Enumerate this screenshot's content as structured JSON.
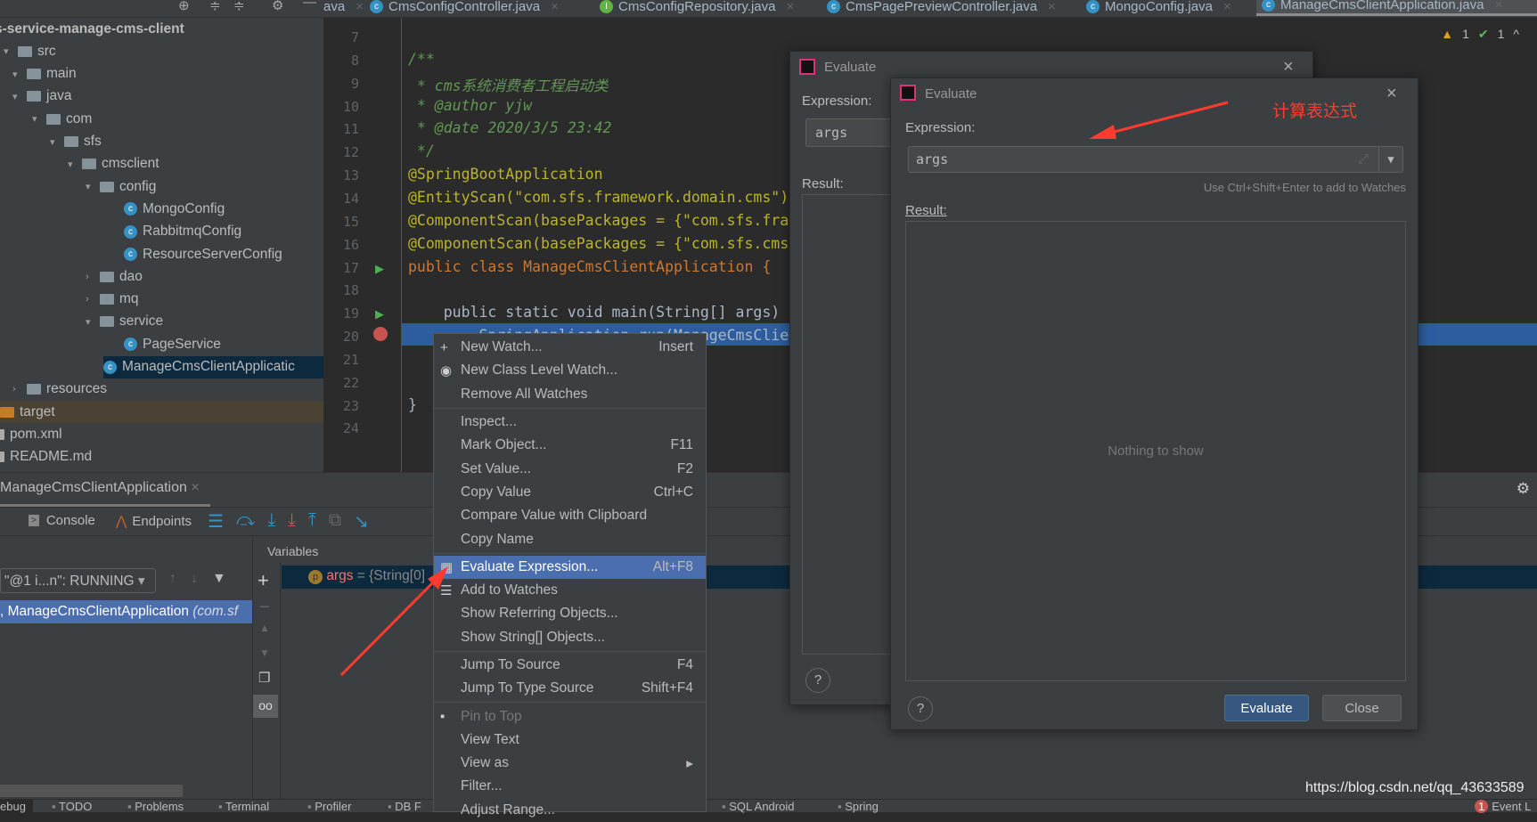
{
  "editor_tabs": [
    {
      "label": "ava",
      "icon": "none"
    },
    {
      "label": "CmsConfigController.java",
      "icon": "class-icon"
    },
    {
      "label": "CmsConfigRepository.java",
      "icon": "interface-icon"
    },
    {
      "label": "CmsPagePreviewController.java",
      "icon": "class-icon"
    },
    {
      "label": "MongoConfig.java",
      "icon": "class-icon"
    },
    {
      "label": "ManageCmsClientApplication.java",
      "icon": "spring-class-icon",
      "active": true
    }
  ],
  "inspections": {
    "warnings": "1",
    "ok": "1"
  },
  "project_tree": [
    {
      "label": "s-service-manage-cms-client",
      "bold": true
    },
    {
      "label": "src",
      "type": "folder"
    },
    {
      "label": "main",
      "type": "folder"
    },
    {
      "label": "java",
      "type": "folder"
    },
    {
      "label": "com",
      "type": "package"
    },
    {
      "label": "sfs",
      "type": "package"
    },
    {
      "label": "cmsclient",
      "type": "package"
    },
    {
      "label": "config",
      "type": "package"
    },
    {
      "label": "MongoConfig",
      "type": "class"
    },
    {
      "label": "RabbitmqConfig",
      "type": "class"
    },
    {
      "label": "ResourceServerConfig",
      "type": "class"
    },
    {
      "label": "dao",
      "type": "package"
    },
    {
      "label": "mq",
      "type": "package"
    },
    {
      "label": "service",
      "type": "package"
    },
    {
      "label": "PageService",
      "type": "class"
    },
    {
      "label": "ManageCmsClientApplicatic",
      "type": "class"
    },
    {
      "label": "resources",
      "type": "folder"
    },
    {
      "label": "target",
      "type": "folder"
    },
    {
      "label": "pom.xml",
      "type": "file"
    },
    {
      "label": "README.md",
      "type": "file"
    }
  ],
  "code_lines": [
    {
      "n": "7",
      "t": ""
    },
    {
      "n": "8",
      "t": "/**"
    },
    {
      "n": "9",
      "t": " * cms系统消费者工程启动类"
    },
    {
      "n": "10",
      "t": " * @author yjw"
    },
    {
      "n": "11",
      "t": " * @date 2020/3/5 23:42"
    },
    {
      "n": "12",
      "t": " */"
    },
    {
      "n": "13",
      "t": "@SpringBootApplication"
    },
    {
      "n": "14",
      "t": "@EntityScan(\"com.sfs.framework.domain.cms\")"
    },
    {
      "n": "15",
      "t": "@ComponentScan(basePackages = {\"com.sfs.fra"
    },
    {
      "n": "16",
      "t": "@ComponentScan(basePackages = {\"com.sfs.cms"
    },
    {
      "n": "17",
      "t": "public class ManageCmsClientApplication {"
    },
    {
      "n": "18",
      "t": ""
    },
    {
      "n": "19",
      "t": "    public static void main(String[] args)"
    },
    {
      "n": "20",
      "t": "        SpringApplication.run(ManageCmsClie"
    },
    {
      "n": "21",
      "t": ""
    },
    {
      "n": "22",
      "t": ""
    },
    {
      "n": "23",
      "t": "}"
    },
    {
      "n": "24",
      "t": ""
    }
  ],
  "debug": {
    "session_tab": "ManageCmsClientApplication",
    "console_tab": "Console",
    "endpoints_tab": "Endpoints",
    "thread_select": "\"@1 i...n\": RUNNING",
    "frame": ", ManageCmsClientApplication",
    "frame_pkg": "(com.sf",
    "variables_header": "Variables",
    "variable_name": "args",
    "variable_value": " = {String[0]"
  },
  "context_menu": [
    {
      "label": "New Watch...",
      "shortcut": "Insert",
      "icon": "plus-icon"
    },
    {
      "label": "New Class Level Watch...",
      "icon": "class-watch-icon"
    },
    {
      "label": "Remove All Watches"
    },
    {
      "sep": true
    },
    {
      "label": "Inspect..."
    },
    {
      "label": "Mark Object...",
      "shortcut": "F11"
    },
    {
      "label": "Set Value...",
      "shortcut": "F2"
    },
    {
      "label": "Copy Value",
      "shortcut": "Ctrl+C"
    },
    {
      "label": "Compare Value with Clipboard"
    },
    {
      "label": "Copy Name"
    },
    {
      "sep": true
    },
    {
      "label": "Evaluate Expression...",
      "shortcut": "Alt+F8",
      "icon": "calculator-icon",
      "selected": true
    },
    {
      "label": "Add to Watches",
      "icon": "watches-icon"
    },
    {
      "label": "Show Referring Objects..."
    },
    {
      "label": "Show String[] Objects..."
    },
    {
      "sep": true
    },
    {
      "label": "Jump To Source",
      "shortcut": "F4"
    },
    {
      "label": "Jump To Type Source",
      "shortcut": "Shift+F4"
    },
    {
      "sep": true
    },
    {
      "label": "Pin to Top",
      "icon": "pin-icon",
      "disabled": true
    },
    {
      "label": "View Text"
    },
    {
      "label": "View as",
      "submenu": true
    },
    {
      "label": "Filter..."
    },
    {
      "label": "Adjust Range..."
    }
  ],
  "back_dialog": {
    "title": "Evaluate",
    "expression_label": "Expression:",
    "expression_value": "args",
    "result_label": "Result:"
  },
  "dialog": {
    "title": "Evaluate",
    "expression_label": "Expression:",
    "expression_value": "args",
    "hint": "Use Ctrl+Shift+Enter to add to Watches",
    "result_label": "Result:",
    "empty_text": "Nothing to show",
    "evaluate_button": "Evaluate",
    "close_button": "Close"
  },
  "annotation": {
    "text": "计算表达式",
    "color": "#ff3b30"
  },
  "status_bar": {
    "items": [
      "ebug",
      "TODO",
      "Problems",
      "Terminal",
      "Profiler",
      "DB F",
      "SQL Android",
      "Spring"
    ],
    "event_log": "Event L",
    "event_count": "1",
    "watermark": "https://blog.csdn.net/qq_43633589"
  },
  "colors": {
    "selection": "#4b6eaf",
    "primary_button": "#365880",
    "highlight_line": "#2d5d9e"
  }
}
